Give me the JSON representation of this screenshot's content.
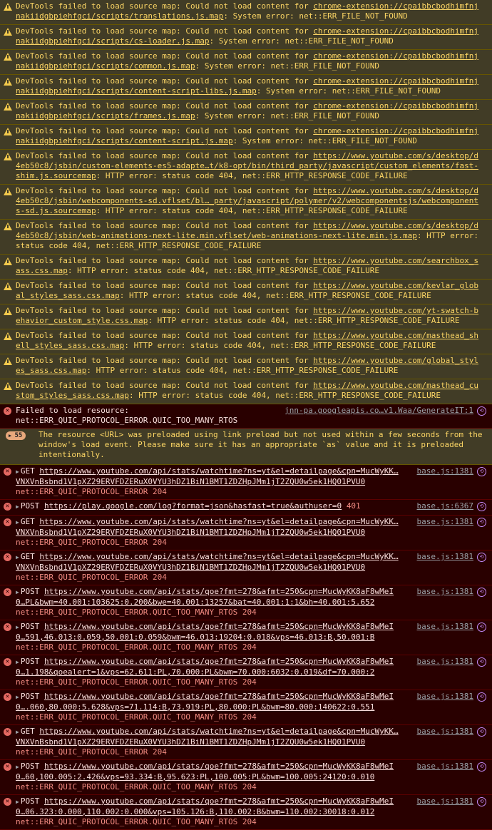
{
  "warnings": [
    {
      "prefix": "DevTools failed to load source map: Could not load content for ",
      "link_a": "chrome-extension://cpaibbcbodhimfnj",
      "link_b": "nakiidgbpiehfgci/scripts/translations.js.map",
      "suffix": ": System error: net::ERR_FILE_NOT_FOUND"
    },
    {
      "prefix": "DevTools failed to load source map: Could not load content for ",
      "link_a": "chrome-extension://cpaibbcbodhimfnj",
      "link_b": "nakiidgbpiehfgci/scripts/cs-loader.js.map",
      "suffix": ": System error: net::ERR_FILE_NOT_FOUND"
    },
    {
      "prefix": "DevTools failed to load source map: Could not load content for ",
      "link_a": "chrome-extension://cpaibbcbodhimfnj",
      "link_b": "nakiidgbpiehfgci/scripts/common.js.map",
      "suffix": ": System error: net::ERR_FILE_NOT_FOUND"
    },
    {
      "prefix": "DevTools failed to load source map: Could not load content for ",
      "link_a": "chrome-extension://cpaibbcbodhimfnj",
      "link_b": "nakiidgbpiehfgci/scripts/content-script-libs.js.map",
      "suffix": ": System error: net::ERR_FILE_NOT_FOUND"
    },
    {
      "prefix": "DevTools failed to load source map: Could not load content for ",
      "link_a": "chrome-extension://cpaibbcbodhimfnj",
      "link_b": "nakiidgbpiehfgci/scripts/frames.js.map",
      "suffix": ": System error: net::ERR_FILE_NOT_FOUND"
    },
    {
      "prefix": "DevTools failed to load source map: Could not load content for ",
      "link_a": "chrome-extension://cpaibbcbodhimfnj",
      "link_b": "nakiidgbpiehfgci/scripts/content-script.js.map",
      "suffix": ": System error: net::ERR_FILE_NOT_FOUND"
    },
    {
      "prefix": "DevTools failed to load source map: Could not load content for ",
      "link_a": "https://www.youtube.com/s/desktop/d",
      "link_b": "4eb50c8/jsbin/custom-elements-es5-adapte…t/k8-opt/bin/third_party/javascript/custom_elements/fast-",
      "link_c": "shim.js.sourcemap",
      "suffix": ": HTTP error: status code 404, net::ERR_HTTP_RESPONSE_CODE_FAILURE"
    },
    {
      "prefix": "DevTools failed to load source map: Could not load content for ",
      "link_a": "https://www.youtube.com/s/desktop/d",
      "link_b": "4eb50c8/jsbin/webcomponents-sd.vflset/bl…_party/javascript/polymer/v2/webcomponentsjs/webcomponent",
      "link_c": "s-sd.js.sourcemap",
      "suffix": ": HTTP error: status code 404, net::ERR_HTTP_RESPONSE_CODE_FAILURE"
    },
    {
      "prefix": "DevTools failed to load source map: Could not load content for ",
      "link_a": "https://www.youtube.com/s/desktop/d",
      "link_b": "4eb50c8/jsbin/web-animations-next-lite.min.vflset/web-animations-next-lite.min.js.map",
      "suffix_inline": ": HTTP error:",
      "suffix": "status code 404, net::ERR_HTTP_RESPONSE_CODE_FAILURE"
    },
    {
      "prefix": "DevTools failed to load source map: Could not load content for ",
      "link_a": "https://www.youtube.com/searchbox_s",
      "link_b": "ass.css.map",
      "suffix": ": HTTP error: status code 404, net::ERR_HTTP_RESPONSE_CODE_FAILURE"
    },
    {
      "prefix": "DevTools failed to load source map: Could not load content for ",
      "link_a": "https://www.youtube.com/kevlar_glob",
      "link_b": "al_styles_sass.css.map",
      "suffix": ": HTTP error: status code 404, net::ERR_HTTP_RESPONSE_CODE_FAILURE"
    },
    {
      "prefix": "DevTools failed to load source map: Could not load content for ",
      "link_a": "https://www.youtube.com/yt-swatch-b",
      "link_b": "ehavior_custom_style.css.map",
      "suffix": ": HTTP error: status code 404, net::ERR_HTTP_RESPONSE_CODE_FAILURE"
    },
    {
      "prefix": "DevTools failed to load source map: Could not load content for ",
      "link_a": "https://www.youtube.com/masthead_sh",
      "link_b": "ell_styles_sass.css.map",
      "suffix": ": HTTP error: status code 404, net::ERR_HTTP_RESPONSE_CODE_FAILURE"
    },
    {
      "prefix": "DevTools failed to load source map: Could not load content for ",
      "link_a": "https://www.youtube.com/global_styl",
      "link_b": "es_sass.css.map",
      "suffix": ": HTTP error: status code 404, net::ERR_HTTP_RESPONSE_CODE_FAILURE"
    },
    {
      "prefix": "DevTools failed to load source map: Could not load content for ",
      "link_a": "https://www.youtube.com/masthead_cu",
      "link_b": "stom_styles_sass.css.map",
      "suffix": ": HTTP error: status code 404, net::ERR_HTTP_RESPONSE_CODE_FAILURE"
    }
  ],
  "resource_error": {
    "line1": "Failed to load resource:",
    "line2": "net::ERR_QUIC_PROTOCOL_ERROR.QUIC_TOO_MANY_RTOS",
    "source": "jnn-pa.googleapis.co…v1.Waa/GenerateIT:1"
  },
  "preload_group": {
    "count": "55",
    "text": "The resource <URL> was preloaded using link preload but not used within a few seconds from the window's load event. Please make sure it has an appropriate `as` value and it is preloaded intentionally."
  },
  "network_errors": [
    {
      "method": "GET",
      "url1": "https://www.youtube.com/api/stats/watchtime?ns=yt&el=detailpage&cpn=MucWyKK…",
      "url2": "VNXVnBsbnd1V1pXZ29ERVFDZERuX0VYU3hDZ1BiN1BMT1ZDZHpJMm1jT2ZQU0w5ek1HQ01PVU0",
      "status": "net::ERR_QUIC_PROTOCOL_ERROR 204",
      "source": "base.js:1381"
    },
    {
      "method": "POST",
      "url1": "https://play.google.com/log?format=json&hasfast=true&authuser=0",
      "code": "401",
      "source": "base.js:6367"
    },
    {
      "method": "GET",
      "url1": "https://www.youtube.com/api/stats/watchtime?ns=yt&el=detailpage&cpn=MucWyKK…",
      "url2": "VNXVnBsbnd1V1pXZ29ERVFDZERuX0VYU3hDZ1BiN1BMT1ZDZHpJMm1jT2ZQU0w5ek1HQ01PVU0",
      "status": "net::ERR_QUIC_PROTOCOL_ERROR 204",
      "source": "base.js:1381"
    },
    {
      "method": "GET",
      "url1": "https://www.youtube.com/api/stats/watchtime?ns=yt&el=detailpage&cpn=MucWyKK…",
      "url2": "VNXVnBsbnd1V1pXZ29ERVFDZERuX0VYU3hDZ1BiN1BMT1ZDZHpJMm1jT2ZQU0w5ek1HQ01PVU0",
      "status": "net::ERR_QUIC_PROTOCOL_ERROR 204",
      "source": "base.js:1381"
    },
    {
      "method": "POST",
      "url1": "https://www.youtube.com/api/stats/qoe?fmt=278&afmt=250&cpn=MucWyKK8aF8wMeI",
      "url2": "0…PL&bwm=40.001:103625:0.200&bwe=40.001:13257&bat=40.001:1:1&bh=40.001:5.652",
      "status": "net::ERR_QUIC_PROTOCOL_ERROR.QUIC_TOO_MANY_RTOS 204",
      "source": "base.js:1381"
    },
    {
      "method": "POST",
      "url1": "https://www.youtube.com/api/stats/qoe?fmt=278&afmt=250&cpn=MucWyKK8aF8wMeI",
      "url2": "0…591,46.013:0.059,50.001:0.059&bwm=46.013:19204:0.018&vps=46.013:B,50.001:B",
      "status": "net::ERR_QUIC_PROTOCOL_ERROR.QUIC_TOO_MANY_RTOS 204",
      "source": "base.js:1381"
    },
    {
      "method": "POST",
      "url1": "https://www.youtube.com/api/stats/qoe?fmt=278&afmt=250&cpn=MucWyKK8aF8wMeI",
      "url2": "0…1.198&qoealert=1&vps=62.611:PL,70.000:PL&bwm=70.000:6032:0.019&df=70.000:2",
      "status": "net::ERR_QUIC_PROTOCOL_ERROR.QUIC_TOO_MANY_RTOS 204",
      "source": "base.js:1381"
    },
    {
      "method": "POST",
      "url1": "https://www.youtube.com/api/stats/qoe?fmt=278&afmt=250&cpn=MucWyKK8aF8wMeI",
      "url2": "0….060,80.000:5.628&vps=71.114:B,73.919:PL,80.000:PL&bwm=80.000:140622:0.551",
      "status": "net::ERR_QUIC_PROTOCOL_ERROR.QUIC_TOO_MANY_RTOS 204",
      "source": "base.js:1381"
    },
    {
      "method": "GET",
      "url1": "https://www.youtube.com/api/stats/watchtime?ns=yt&el=detailpage&cpn=MucWyKK…",
      "url2": "VNXVnBsbnd1V1pXZ29ERVFDZERuX0VYU3hDZ1BiN1BMT1ZDZHpJMm1jT2ZQU0w5ek1HQ01PVU0",
      "status": "net::ERR_QUIC_PROTOCOL_ERROR 204",
      "source": "base.js:1381"
    },
    {
      "method": "POST",
      "url1": "https://www.youtube.com/api/stats/qoe?fmt=278&afmt=250&cpn=MucWyKK8aF8wMeI",
      "url2": "0…60,100.005:2.426&vps=93.334:B,95.623:PL,100.005:PL&bwm=100.005:24120:0.010",
      "status": "net::ERR_QUIC_PROTOCOL_ERROR.QUIC_TOO_MANY_RTOS 204",
      "source": "base.js:1381"
    },
    {
      "method": "POST",
      "url1": "https://www.youtube.com/api/stats/qoe?fmt=278&afmt=250&cpn=MucWyKK8aF8wMeI",
      "url2": "0…06.323:0.000,110.002:0.000&vps=105.126:B,110.002:B&bwm=110.002:30018:0.012",
      "status": "net::ERR_QUIC_PROTOCOL_ERROR.QUIC_TOO_MANY_RTOS 204",
      "source": "base.js:1381"
    }
  ],
  "icons": {
    "warning": "warning-icon",
    "error": "error-icon",
    "replay": "replay-icon",
    "expand": "expand-triangle-icon"
  },
  "colors": {
    "warning_bg": "#413c26",
    "warning_text": "#fcd665",
    "error_bg": "#290000",
    "error_text": "#f28b82",
    "console_bg": "#242424"
  }
}
